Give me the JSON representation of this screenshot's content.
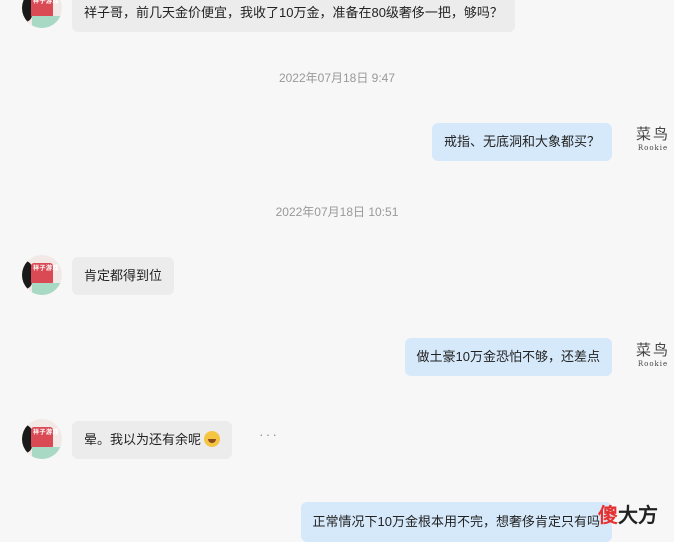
{
  "messages": [
    {
      "side": "in",
      "text": "祥子哥，前几天金价便宜，我收了10万金，准备在80级奢侈一把，够吗？"
    },
    {
      "side": "out",
      "text": "戒指、无底洞和大象都买？"
    },
    {
      "side": "in",
      "text": "肯定都得到位"
    },
    {
      "side": "out",
      "text": "做土豪10万金恐怕不够，还差点"
    },
    {
      "side": "in",
      "text": "晕。我以为还有余呢"
    },
    {
      "side": "out",
      "text": "正常情况下10万金根本用不完，想奢侈肯定只有吗"
    }
  ],
  "timestamps": [
    "2022年07月18日 9:47",
    "2022年07月18日 10:51"
  ],
  "avatar_left": {
    "seal_text": "祥子游戏"
  },
  "avatar_right": {
    "name_cn": "菜鸟",
    "name_en": "Rookie"
  },
  "more_label": "···",
  "watermark": {
    "part1": "傻",
    "part2": "大方"
  },
  "colors": {
    "incoming_bubble": "#ececec",
    "outgoing_bubble": "#d6e9fb",
    "background": "#f7f7f7"
  }
}
